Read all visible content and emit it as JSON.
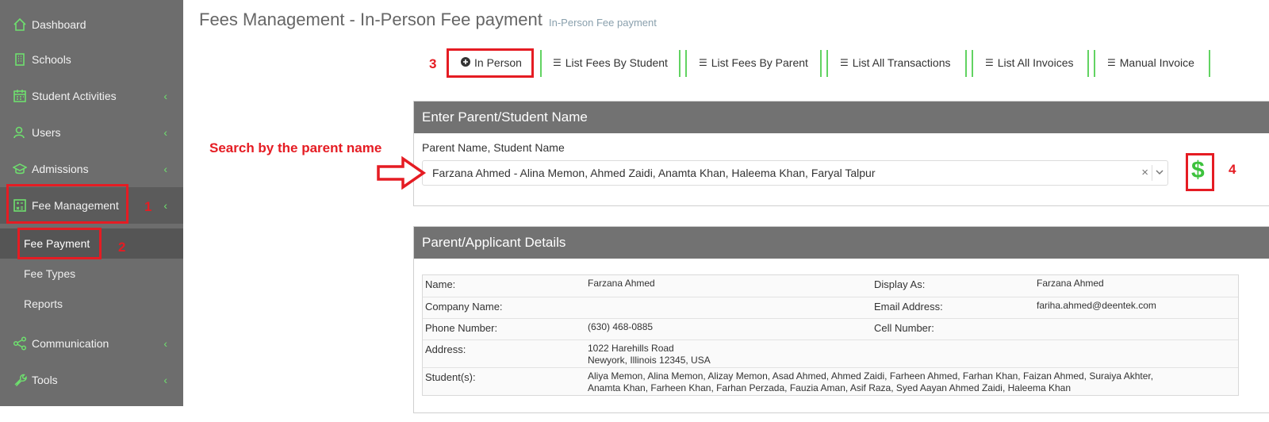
{
  "sidebar": {
    "items": [
      {
        "label": "Dashboard",
        "icon": "home-icon"
      },
      {
        "label": "Schools",
        "icon": "building-icon"
      },
      {
        "label": "Student Activities",
        "icon": "calendar-icon"
      },
      {
        "label": "Users",
        "icon": "users-icon"
      },
      {
        "label": "Admissions",
        "icon": "graduation-cap-icon"
      },
      {
        "label": "Fee Management",
        "icon": "calculator-icon"
      },
      {
        "label": "Communication",
        "icon": "share-icon"
      },
      {
        "label": "Tools",
        "icon": "wrench-icon"
      }
    ],
    "fee_submenu": [
      {
        "label": "Fee Payment"
      },
      {
        "label": "Fee Types"
      },
      {
        "label": "Reports"
      }
    ],
    "chevron": "‹"
  },
  "header": {
    "title": "Fees Management - In-Person Fee payment",
    "subtitle": "In-Person Fee payment"
  },
  "tabs": [
    {
      "label": "In Person",
      "icon": "plus-circle-icon"
    },
    {
      "label": "List Fees By Student",
      "icon": "list-icon"
    },
    {
      "label": "List Fees By Parent",
      "icon": "list-icon"
    },
    {
      "label": "List All Transactions",
      "icon": "list-icon"
    },
    {
      "label": "List All Invoices",
      "icon": "list-icon"
    },
    {
      "label": "Manual Invoice",
      "icon": "list-icon"
    }
  ],
  "search_panel": {
    "heading": "Enter Parent/Student Name",
    "field_label": "Parent Name, Student Name",
    "selected_value": "Farzana Ahmed - Alina Memon, Ahmed Zaidi, Anamta Khan, Haleema Khan, Faryal Talpur",
    "clear_glyph": "×",
    "pay_glyph": "$"
  },
  "details_panel": {
    "heading": "Parent/Applicant Details",
    "name_label": "Name:",
    "name_value": "Farzana Ahmed",
    "display_as_label": "Display As:",
    "display_as_value": "Farzana Ahmed",
    "company_label": "Company Name:",
    "email_label": "Email Address:",
    "email_value": "fariha.ahmed@deentek.com",
    "phone_label": "Phone Number:",
    "phone_value": "(630) 468-0885",
    "cell_label": "Cell Number:",
    "address_label": "Address:",
    "address_line1": "1022 Harehills Road",
    "address_line2": "Newyork, Illinois 12345, USA",
    "students_label": "Student(s):",
    "students_line1": "Aliya Memon, Alina Memon, Alizay Memon, Asad Ahmed, Ahmed Zaidi, Farheen Ahmed, Farhan Khan, Faizan Ahmed, Suraiya Akhter,",
    "students_line2": "Anamta Khan, Farheen Khan, Farhan Perzada, Fauzia Aman, Asif Raza, Syed Aayan Ahmed Zaidi, Haleema Khan"
  },
  "annotations": {
    "n1": "1",
    "n2": "2",
    "n3": "3",
    "n4": "4",
    "search_hint": "Search by the parent name"
  },
  "colors": {
    "sidebar_bg": "#6d6d6d",
    "accent_green": "#3dc23d",
    "annotation_red": "#e51c23",
    "panel_header_bg": "#727272"
  }
}
